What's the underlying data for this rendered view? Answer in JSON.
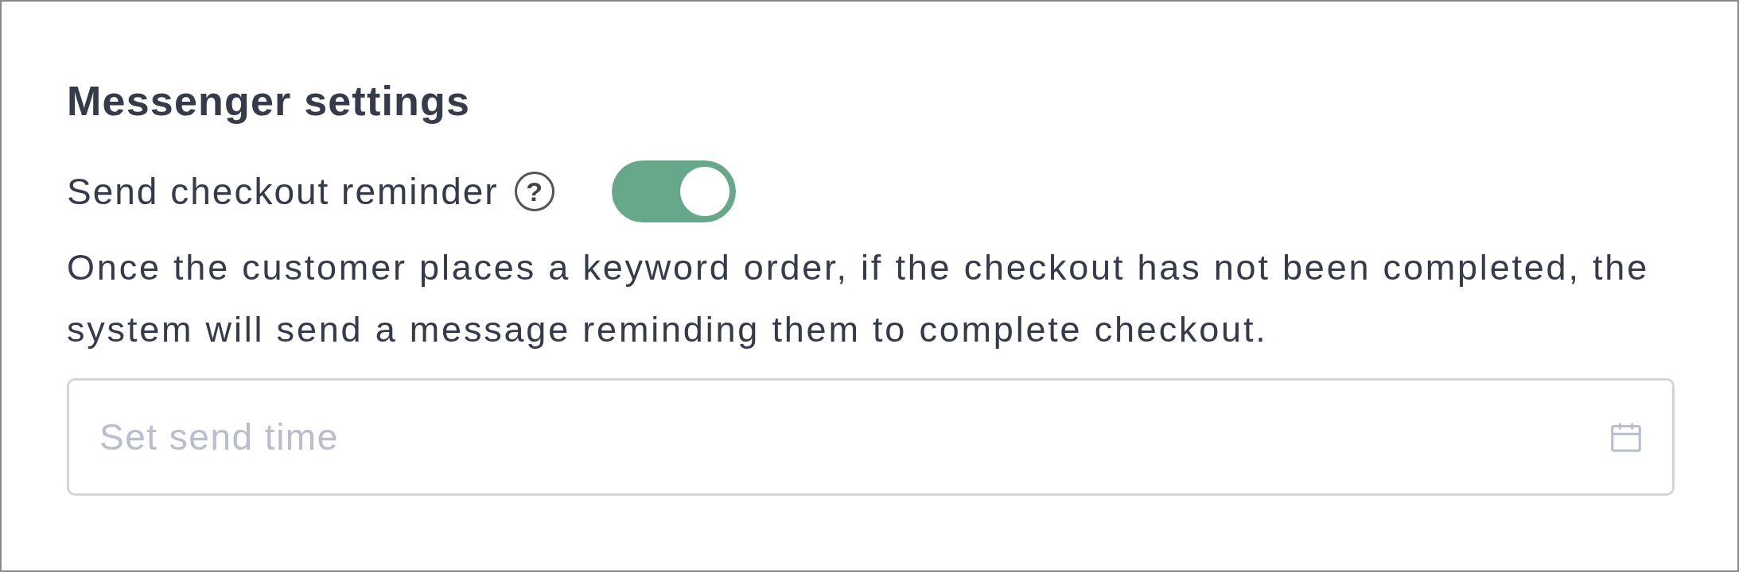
{
  "section": {
    "title": "Messenger settings"
  },
  "setting": {
    "label": "Send checkout reminder",
    "help": "?",
    "on": true
  },
  "description": "Once the customer places a keyword order, if the checkout has not been completed, the system will send a message reminding them to complete checkout.",
  "send_time": {
    "placeholder": "Set send time"
  }
}
